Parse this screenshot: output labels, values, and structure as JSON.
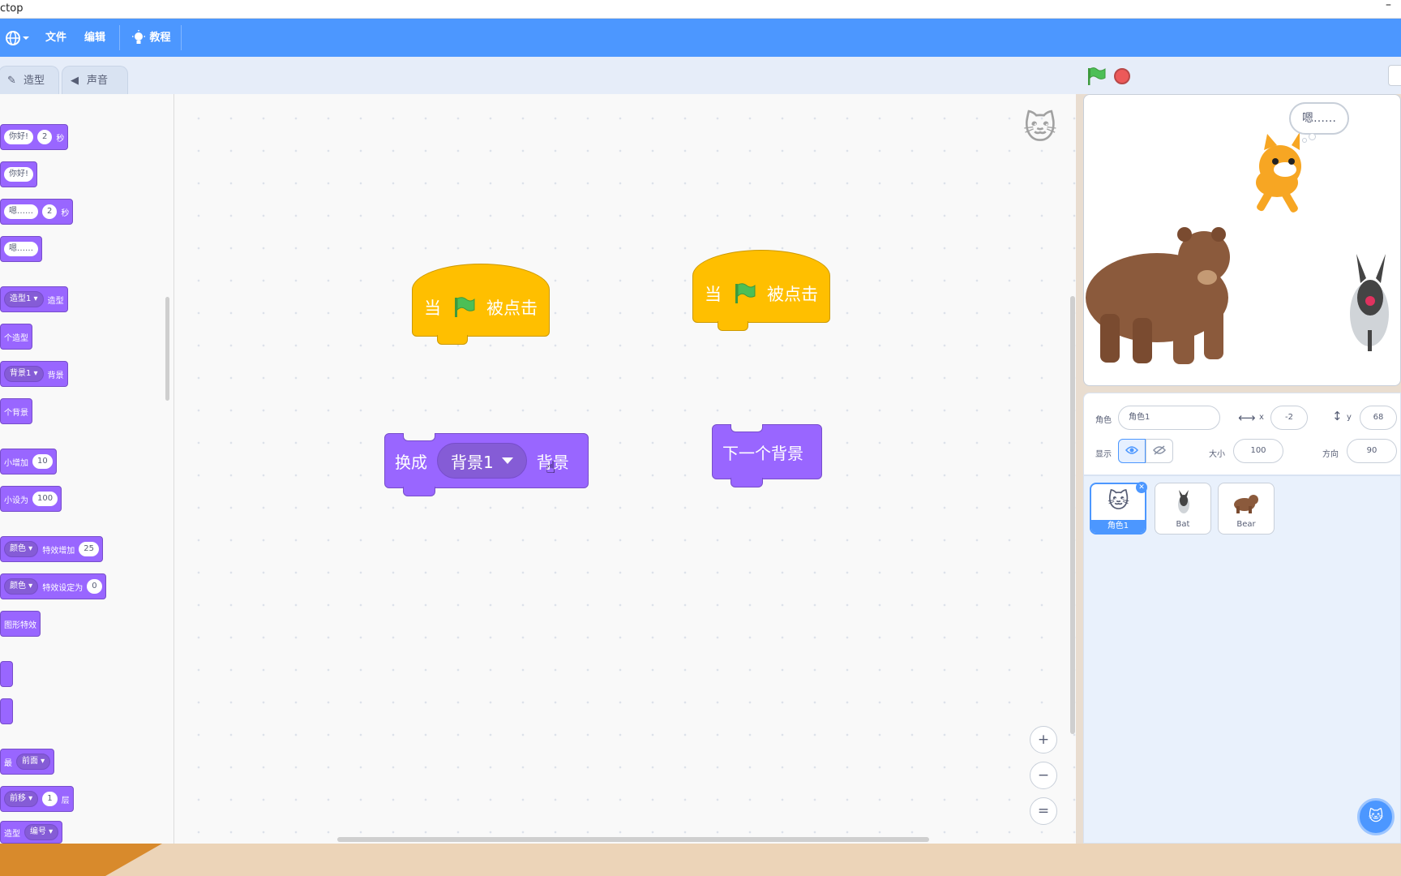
{
  "window": {
    "title": "ctop",
    "minimize": "–"
  },
  "menubar": {
    "file": "文件",
    "edit": "编辑",
    "tutorial": "教程"
  },
  "tabs": {
    "costumes": "造型",
    "sounds": "声音"
  },
  "palette": {
    "say_secs": {
      "text": "你好!",
      "secs": "2",
      "unit": "秒"
    },
    "say": {
      "text": "你好!"
    },
    "think_secs": {
      "text": "嗯……",
      "secs": "2",
      "unit": "秒"
    },
    "think": {
      "text": "嗯……"
    },
    "switch_costume": {
      "menu": "造型1",
      "suffix": "造型"
    },
    "next_costume": "个造型",
    "switch_backdrop": {
      "menu": "背景1",
      "suffix": "背景"
    },
    "next_backdrop": "个背景",
    "change_size": {
      "label": "小增加",
      "value": "10"
    },
    "set_size": {
      "label": "小设为",
      "value": "100"
    },
    "change_effect": {
      "menu": "颜色",
      "label": "特效增加",
      "value": "25"
    },
    "set_effect": {
      "menu": "颜色",
      "label": "特效设定为",
      "value": "0"
    },
    "clear_effects": "图形特效",
    "go_layer": {
      "prefix": "最",
      "menu": "前面"
    },
    "move_layer": {
      "menu": "前移",
      "value": "1",
      "unit": "层"
    },
    "costume_number": {
      "prefix": "造型",
      "menu": "编号"
    }
  },
  "scripts": {
    "hat1": {
      "left": "当",
      "right": "被点击"
    },
    "hat2": {
      "left": "当",
      "right": "被点击"
    },
    "switch_backdrop": {
      "label": "换成",
      "menu": "背景1",
      "suffix": "背景"
    },
    "next_backdrop": "下一个背景"
  },
  "workspace": {
    "zoom_in": "+",
    "zoom_out": "−",
    "reset": "="
  },
  "stage": {
    "bubble": "嗯……"
  },
  "sprite_info": {
    "sprite_label": "角色",
    "sprite_name": "角色1",
    "x_label": "x",
    "x": "-2",
    "y_label": "y",
    "y": "68",
    "show_label": "显示",
    "size_label": "大小",
    "size": "100",
    "direction_label": "方向",
    "direction": "90"
  },
  "sprites": [
    {
      "name": "角色1",
      "selected": true
    },
    {
      "name": "Bat",
      "selected": false
    },
    {
      "name": "Bear",
      "selected": false
    }
  ],
  "colors": {
    "accent": "#4c97ff",
    "looks": "#9966ff",
    "events": "#ffbf00"
  }
}
